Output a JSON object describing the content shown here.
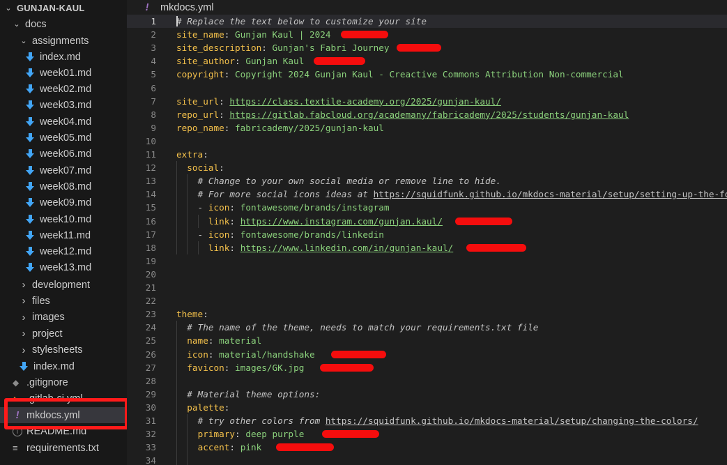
{
  "explorer": {
    "root": "GUNJAN-KAUL",
    "docs": "docs",
    "assignments": "assignments",
    "assignment_files": [
      "index.md",
      "week01.md",
      "week02.md",
      "week03.md",
      "week04.md",
      "week05.md",
      "week06.md",
      "week07.md",
      "week08.md",
      "week09.md",
      "week10.md",
      "week11.md",
      "week12.md",
      "week13.md"
    ],
    "folders": [
      "development",
      "files",
      "images",
      "project",
      "stylesheets"
    ],
    "docs_index": "index.md",
    "root_files": {
      "gitignore": ".gitignore",
      "gitlab_ci": ".gitlab-ci.yml",
      "mkdocs": "mkdocs.yml",
      "readme": "README.md",
      "requirements": "requirements.txt"
    }
  },
  "editor": {
    "tab_title": "mkdocs.yml",
    "lines": [
      {
        "n": "1",
        "segs": [
          [
            "c",
            "# Replace the text below to customize your site"
          ]
        ]
      },
      {
        "n": "2",
        "segs": [
          [
            "k",
            "site_name"
          ],
          [
            "p",
            ": "
          ],
          [
            "v",
            "Gunjan Kaul | 2024"
          ]
        ]
      },
      {
        "n": "3",
        "segs": [
          [
            "k",
            "site_description"
          ],
          [
            "p",
            ": "
          ],
          [
            "v",
            "Gunjan's Fabri Journey"
          ]
        ]
      },
      {
        "n": "4",
        "segs": [
          [
            "k",
            "site_author"
          ],
          [
            "p",
            ": "
          ],
          [
            "v",
            "Gunjan Kaul"
          ]
        ]
      },
      {
        "n": "5",
        "segs": [
          [
            "k",
            "copyright"
          ],
          [
            "p",
            ": "
          ],
          [
            "v",
            "Copyright 2024 Gunjan Kaul - Creactive Commons Attribution Non-commercial"
          ]
        ]
      },
      {
        "n": "6",
        "segs": []
      },
      {
        "n": "7",
        "segs": [
          [
            "k",
            "site_url"
          ],
          [
            "p",
            ": "
          ],
          [
            "u",
            "https://class.textile-academy.org/2025/gunjan-kaul/"
          ]
        ]
      },
      {
        "n": "8",
        "segs": [
          [
            "k",
            "repo_url"
          ],
          [
            "p",
            ": "
          ],
          [
            "u",
            "https://gitlab.fabcloud.org/academany/fabricademy/2025/students/gunjan-kaul"
          ]
        ]
      },
      {
        "n": "9",
        "segs": [
          [
            "k",
            "repo_name"
          ],
          [
            "p",
            ": "
          ],
          [
            "v",
            "fabricademy/2025/gunjan-kaul"
          ]
        ]
      },
      {
        "n": "10",
        "segs": []
      },
      {
        "n": "11",
        "segs": [
          [
            "k",
            "extra"
          ],
          [
            "p",
            ":"
          ]
        ]
      },
      {
        "n": "12",
        "segs": [
          [
            "p",
            "  "
          ],
          [
            "k",
            "social"
          ],
          [
            "p",
            ":"
          ]
        ]
      },
      {
        "n": "13",
        "segs": [
          [
            "p",
            "    "
          ],
          [
            "c",
            "# Change to your own social media or remove line to hide."
          ]
        ]
      },
      {
        "n": "14",
        "segs": [
          [
            "p",
            "    "
          ],
          [
            "c",
            "# For more social icons ideas at "
          ],
          [
            "uc",
            "https://squidfunk.github.io/mkdocs-material/setup/setting-up-the-fo"
          ]
        ]
      },
      {
        "n": "15",
        "segs": [
          [
            "p",
            "    - "
          ],
          [
            "k",
            "icon"
          ],
          [
            "p",
            ": "
          ],
          [
            "v",
            "fontawesome/brands/instagram"
          ]
        ]
      },
      {
        "n": "16",
        "segs": [
          [
            "p",
            "      "
          ],
          [
            "k",
            "link"
          ],
          [
            "p",
            ": "
          ],
          [
            "u",
            "https://www.instagram.com/gunjan.kaul/"
          ]
        ]
      },
      {
        "n": "17",
        "segs": [
          [
            "p",
            "    - "
          ],
          [
            "k",
            "icon"
          ],
          [
            "p",
            ": "
          ],
          [
            "v",
            "fontawesome/brands/linkedin"
          ]
        ]
      },
      {
        "n": "18",
        "segs": [
          [
            "p",
            "      "
          ],
          [
            "k",
            "link"
          ],
          [
            "p",
            ": "
          ],
          [
            "u",
            "https://www.linkedin.com/in/gunjan-kaul/"
          ]
        ]
      },
      {
        "n": "19",
        "segs": []
      },
      {
        "n": "20",
        "segs": []
      },
      {
        "n": "21",
        "segs": []
      },
      {
        "n": "22",
        "segs": []
      },
      {
        "n": "23",
        "segs": [
          [
            "k",
            "theme"
          ],
          [
            "p",
            ":"
          ]
        ]
      },
      {
        "n": "24",
        "segs": [
          [
            "p",
            "  "
          ],
          [
            "c",
            "# The name of the theme, needs to match your requirements.txt file"
          ]
        ]
      },
      {
        "n": "25",
        "segs": [
          [
            "p",
            "  "
          ],
          [
            "k",
            "name"
          ],
          [
            "p",
            ": "
          ],
          [
            "v",
            "material"
          ]
        ]
      },
      {
        "n": "26",
        "segs": [
          [
            "p",
            "  "
          ],
          [
            "k",
            "icon"
          ],
          [
            "p",
            ": "
          ],
          [
            "v",
            "material/handshake"
          ]
        ]
      },
      {
        "n": "27",
        "segs": [
          [
            "p",
            "  "
          ],
          [
            "k",
            "favicon"
          ],
          [
            "p",
            ": "
          ],
          [
            "v",
            "images/GK.jpg"
          ]
        ]
      },
      {
        "n": "28",
        "segs": []
      },
      {
        "n": "29",
        "segs": [
          [
            "p",
            "  "
          ],
          [
            "c",
            "# Material theme options:"
          ]
        ]
      },
      {
        "n": "30",
        "segs": [
          [
            "p",
            "  "
          ],
          [
            "k",
            "palette"
          ],
          [
            "p",
            ":"
          ]
        ]
      },
      {
        "n": "31",
        "segs": [
          [
            "p",
            "    "
          ],
          [
            "c",
            "# try other colors from "
          ],
          [
            "uc",
            "https://squidfunk.github.io/mkdocs-material/setup/changing-the-colors/"
          ]
        ]
      },
      {
        "n": "32",
        "segs": [
          [
            "p",
            "    "
          ],
          [
            "k",
            "primary"
          ],
          [
            "p",
            ": "
          ],
          [
            "v",
            "deep purple"
          ]
        ]
      },
      {
        "n": "33",
        "segs": [
          [
            "p",
            "    "
          ],
          [
            "k",
            "accent"
          ],
          [
            "p",
            ": "
          ],
          [
            "v",
            "pink"
          ]
        ]
      },
      {
        "n": "34",
        "segs": []
      }
    ]
  }
}
